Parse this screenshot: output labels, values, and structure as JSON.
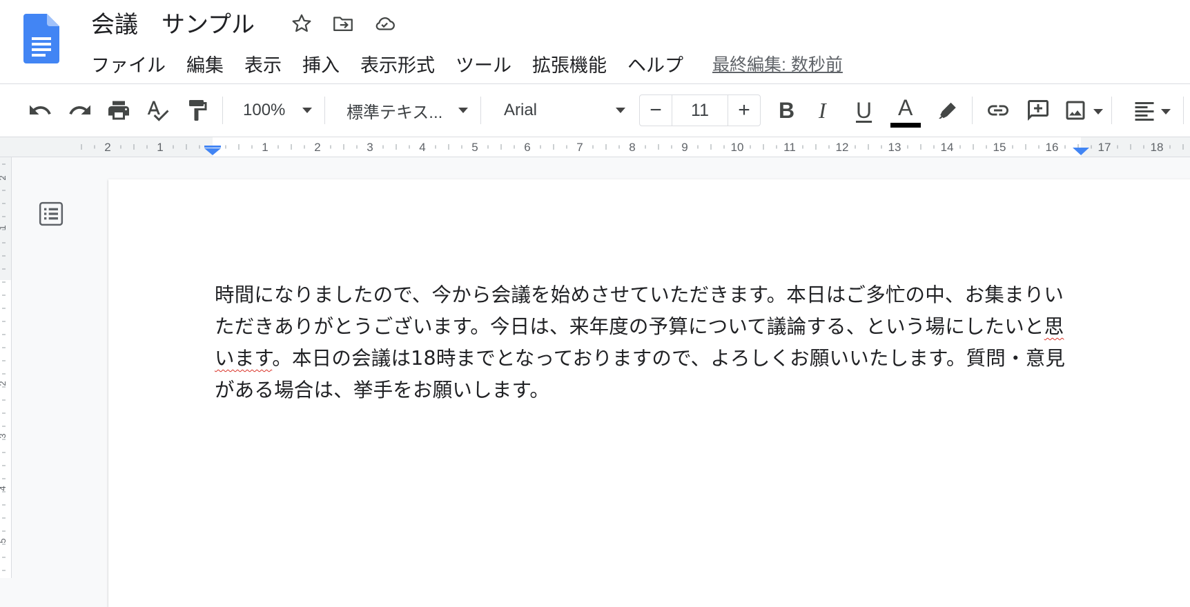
{
  "doc": {
    "title": "会議　サンプル",
    "last_edit": "最終編集: 数秒前"
  },
  "menu": [
    "ファイル",
    "編集",
    "表示",
    "挿入",
    "表示形式",
    "ツール",
    "拡張機能",
    "ヘルプ"
  ],
  "toolbar": {
    "zoom": "100%",
    "style": "標準テキス...",
    "font": "Arial",
    "font_size": "11",
    "minus": "−",
    "plus": "+",
    "bold": "B",
    "italic": "I",
    "underline": "U",
    "text_color_letter": "A",
    "text_color": "#000000",
    "icons": [
      "undo-icon",
      "redo-icon",
      "print-icon",
      "spellcheck-icon",
      "paint-format-icon",
      "highlighter-icon",
      "link-icon",
      "add-comment-icon",
      "insert-image-icon",
      "align-left-icon"
    ]
  },
  "ruler": {
    "labels": [
      "2",
      "1",
      "1",
      "2",
      "3",
      "4",
      "5",
      "6",
      "7",
      "8",
      "9",
      "10",
      "11",
      "12",
      "13",
      "14",
      "15",
      "16",
      "17",
      "18"
    ],
    "vertical_labels": [
      "2",
      "1",
      "2",
      "3",
      "4",
      "5"
    ]
  },
  "body": {
    "line1": "時間になりましたので、今から会議を始めさせていただきます。本日はご多忙の中、お集まりい",
    "line2_main": "ただきありがとうございます。今日は、来年度の予算について議論する、という場にしたいと",
    "line2_flagged": "思",
    "line3_flagged": "います",
    "line3_rest": "。本日の会議は18時までとなっておりますので、よろしくお願いいたします。質問・意見",
    "line4": "がある場合は、挙手をお願いします。"
  },
  "colors": {
    "brand": "#4285f4",
    "ruler_marker": "#4285f4",
    "spellcheck": "#d93025"
  }
}
